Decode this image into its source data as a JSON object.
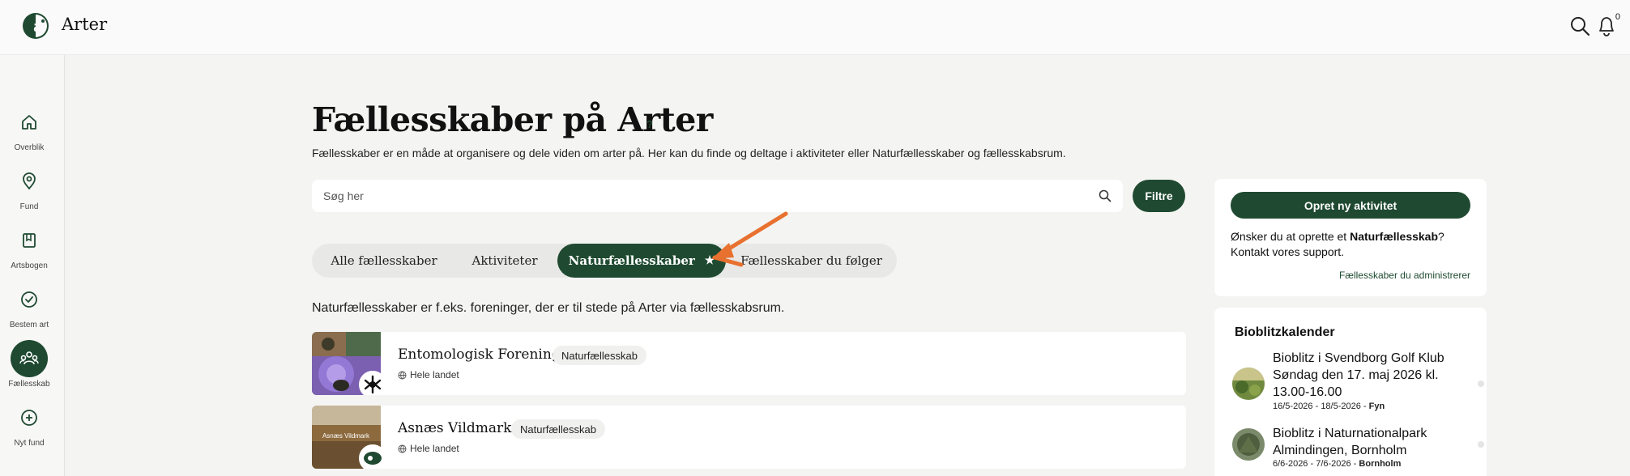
{
  "header": {
    "app_title": "Arter",
    "notification_count": "0"
  },
  "sidebar": {
    "items": [
      {
        "label": "Overblik",
        "icon": "home-icon"
      },
      {
        "label": "Fund",
        "icon": "location-pin-icon"
      },
      {
        "label": "Artsbogen",
        "icon": "book-icon"
      },
      {
        "label": "Bestem art",
        "icon": "check-circle-icon"
      },
      {
        "label": "Fællesskab",
        "icon": "community-icon",
        "active": true
      },
      {
        "label": "Nyt fund",
        "icon": "plus-circle-icon"
      }
    ]
  },
  "main": {
    "title": "Fællesskaber på Arter",
    "help_label": "?",
    "intro": "Fællesskaber er en måde at organisere og dele viden om arter på. Her kan du finde og deltage i aktiviteter eller Naturfællesskaber og fællesskabsrum.",
    "search": {
      "placeholder": "Søg her",
      "value": ""
    },
    "filter_label": "Filtre",
    "tabs": [
      {
        "label": "Alle fællesskaber"
      },
      {
        "label": "Aktiviteter"
      },
      {
        "label": "Naturfællesskaber",
        "star": "★",
        "active": true
      },
      {
        "label": "Fællesskaber du følger"
      }
    ],
    "tab_description": "Naturfællesskaber er f.eks. foreninger, der er til stede på Arter via fællesskabsrum.",
    "communities": [
      {
        "name": "Entomologisk Forening",
        "tag": "Naturfællesskab",
        "location": "Hele landet"
      },
      {
        "name": "Asnæs Vildmark",
        "tag": "Naturfællesskab",
        "location": "Hele landet",
        "image_text": "Asnæs Vildmark"
      }
    ]
  },
  "right_panel": {
    "create_button": "Opret ny aktivitet",
    "text_before": "Ønsker du at oprette et ",
    "text_bold": "Naturfællesskab",
    "text_after": "? Kontakt vores support.",
    "admin_link": "Fællesskaber du administrerer"
  },
  "calendar": {
    "title": "Bioblitzkalender",
    "events": [
      {
        "title": "Bioblitz i Svendborg Golf Klub Søndag den 17. maj 2026 kl. 13.00-16.00",
        "dates": "16/5-2026 - 18/5-2026 - ",
        "region": "Fyn"
      },
      {
        "title": "Bioblitz i Naturnationalpark Almindingen, Bornholm",
        "dates": "6/6-2026 - 7/6-2026 - ",
        "region": "Bornholm"
      }
    ]
  },
  "colors": {
    "brand_green": "#1f4a31",
    "annotation_arrow": "#e8712f",
    "background": "#f4f4f3"
  }
}
